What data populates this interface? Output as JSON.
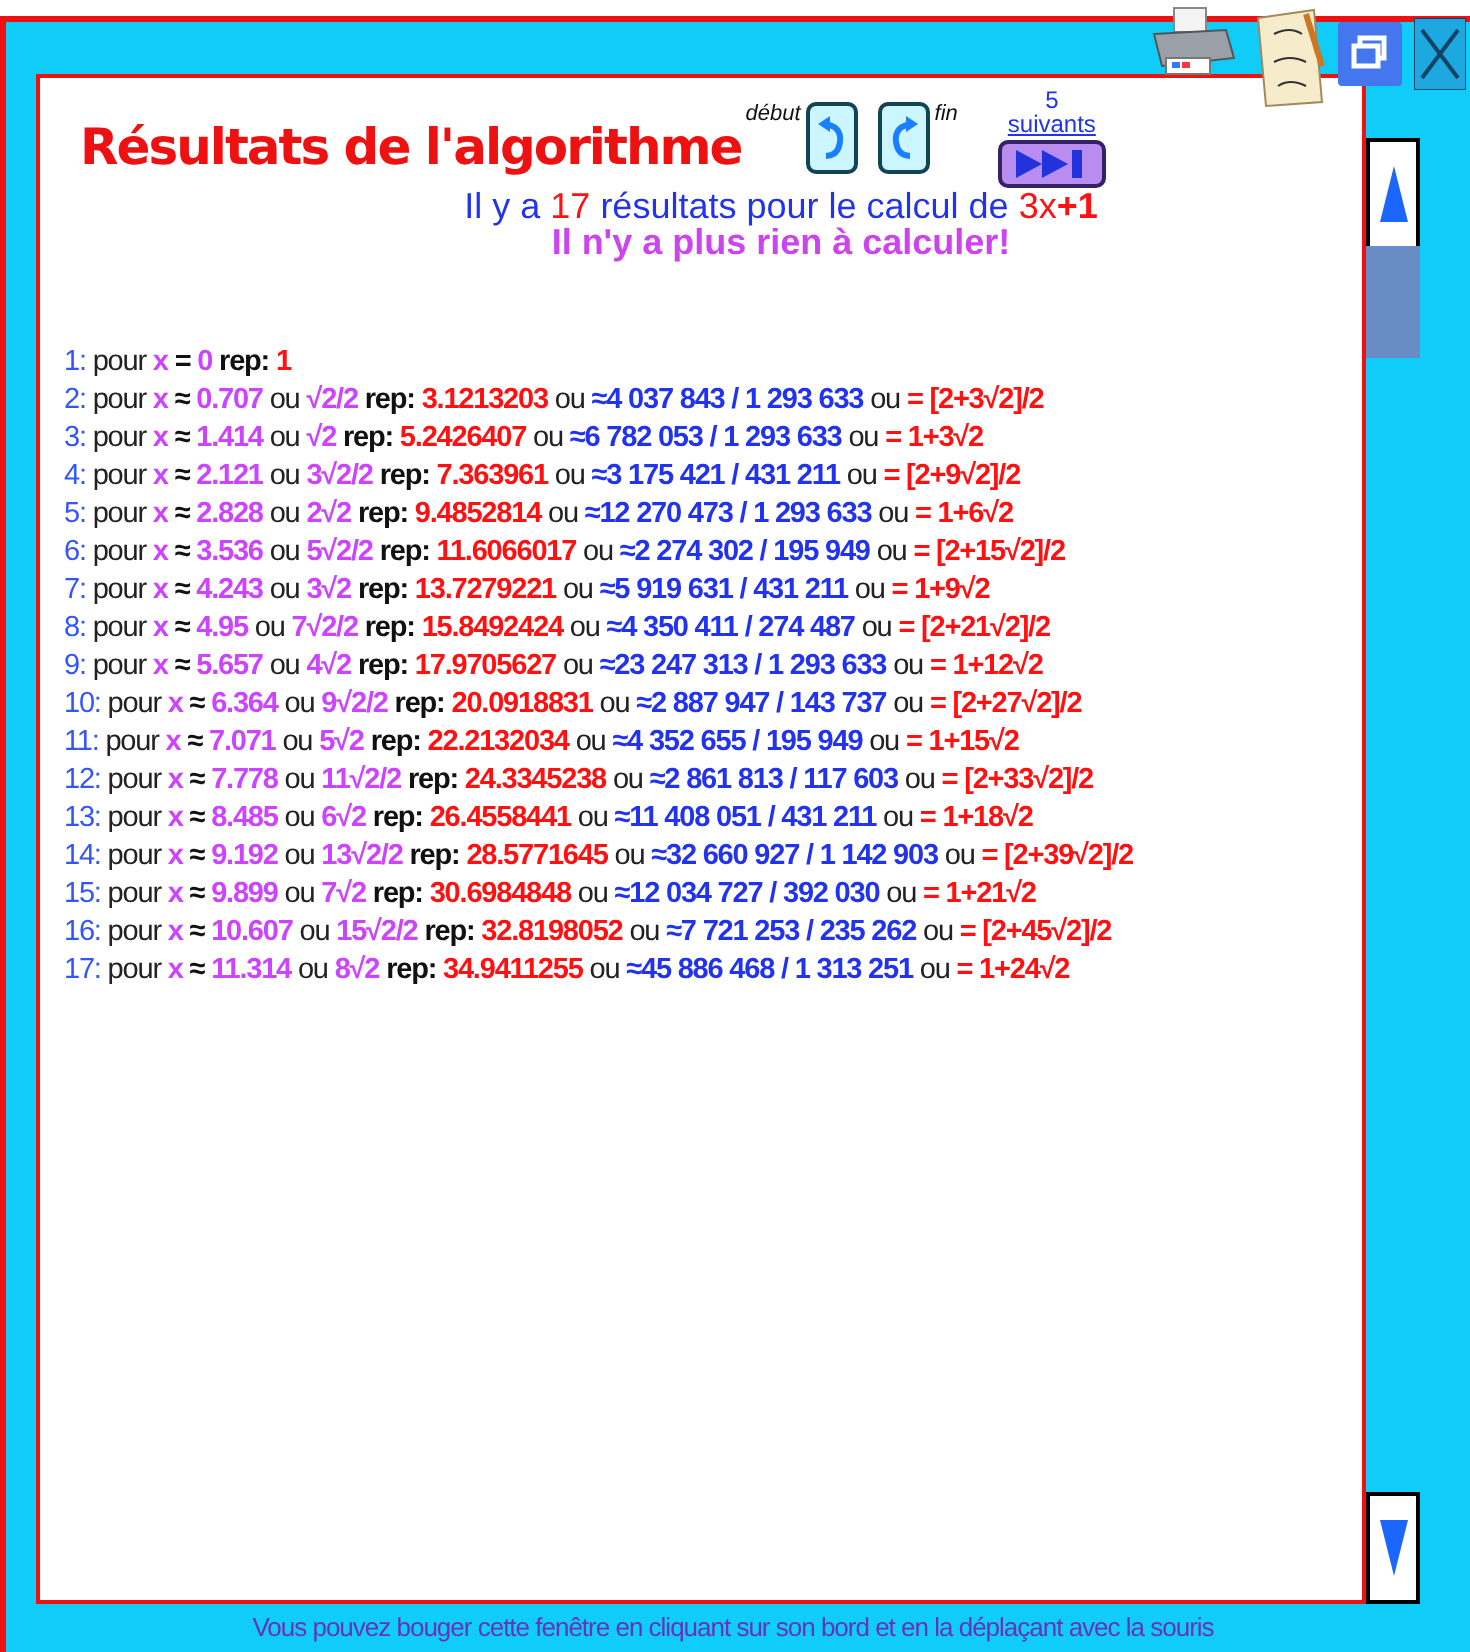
{
  "title": "Résultats de l'algorithme",
  "nav": {
    "start_label": "début",
    "end_label": "fin",
    "next_count": "5",
    "next_label": "suivants"
  },
  "summary": [
    {
      "kind": "text",
      "text": "Il y a "
    },
    {
      "kind": "num",
      "text": "17"
    },
    {
      "kind": "text",
      "text": " résultats pour le calcul de "
    },
    {
      "kind": "num",
      "text": "3x"
    },
    {
      "kind": "strong",
      "text": "+1"
    }
  ],
  "status": "Il n'y a plus rien à calculer!",
  "rows": [
    [
      {
        "kind": "index",
        "text": "1:"
      },
      {
        "kind": "word",
        "text": "pour"
      },
      {
        "kind": "var",
        "text": "x"
      },
      {
        "kind": "op",
        "text": "="
      },
      {
        "kind": "xval",
        "text": "0"
      },
      {
        "kind": "label",
        "text": "rep:"
      },
      {
        "kind": "rep",
        "text": "1"
      }
    ],
    [
      {
        "kind": "index",
        "text": "2:"
      },
      {
        "kind": "word",
        "text": "pour"
      },
      {
        "kind": "var",
        "text": "x"
      },
      {
        "kind": "op",
        "text": "≈"
      },
      {
        "kind": "xval",
        "text": "0.707"
      },
      {
        "kind": "word",
        "text": "ou"
      },
      {
        "kind": "xval",
        "text": "√2/2"
      },
      {
        "kind": "label",
        "text": "rep:"
      },
      {
        "kind": "rep",
        "text": "3.1213203"
      },
      {
        "kind": "word",
        "text": "ou"
      },
      {
        "kind": "frac",
        "text": "≈4 037 843 / 1 293 633"
      },
      {
        "kind": "word",
        "text": "ou"
      },
      {
        "kind": "rep",
        "text": "= [2+3√2]/2"
      }
    ],
    [
      {
        "kind": "index",
        "text": "3:"
      },
      {
        "kind": "word",
        "text": "pour"
      },
      {
        "kind": "var",
        "text": "x"
      },
      {
        "kind": "op",
        "text": "≈"
      },
      {
        "kind": "xval",
        "text": "1.414"
      },
      {
        "kind": "word",
        "text": "ou"
      },
      {
        "kind": "xval",
        "text": "√2"
      },
      {
        "kind": "label",
        "text": "rep:"
      },
      {
        "kind": "rep",
        "text": "5.2426407"
      },
      {
        "kind": "word",
        "text": "ou"
      },
      {
        "kind": "frac",
        "text": "≈6 782 053 / 1 293 633"
      },
      {
        "kind": "word",
        "text": "ou"
      },
      {
        "kind": "rep",
        "text": "= 1+3√2"
      }
    ],
    [
      {
        "kind": "index",
        "text": "4:"
      },
      {
        "kind": "word",
        "text": "pour"
      },
      {
        "kind": "var",
        "text": "x"
      },
      {
        "kind": "op",
        "text": "≈"
      },
      {
        "kind": "xval",
        "text": "2.121"
      },
      {
        "kind": "word",
        "text": "ou"
      },
      {
        "kind": "xval",
        "text": "3√2/2"
      },
      {
        "kind": "label",
        "text": "rep:"
      },
      {
        "kind": "rep",
        "text": "7.363961"
      },
      {
        "kind": "word",
        "text": "ou"
      },
      {
        "kind": "frac",
        "text": "≈3 175 421 / 431 211"
      },
      {
        "kind": "word",
        "text": "ou"
      },
      {
        "kind": "rep",
        "text": "= [2+9√2]/2"
      }
    ],
    [
      {
        "kind": "index",
        "text": "5:"
      },
      {
        "kind": "word",
        "text": "pour"
      },
      {
        "kind": "var",
        "text": "x"
      },
      {
        "kind": "op",
        "text": "≈"
      },
      {
        "kind": "xval",
        "text": "2.828"
      },
      {
        "kind": "word",
        "text": "ou"
      },
      {
        "kind": "xval",
        "text": "2√2"
      },
      {
        "kind": "label",
        "text": "rep:"
      },
      {
        "kind": "rep",
        "text": "9.4852814"
      },
      {
        "kind": "word",
        "text": "ou"
      },
      {
        "kind": "frac",
        "text": "≈12 270 473 / 1 293 633"
      },
      {
        "kind": "word",
        "text": "ou"
      },
      {
        "kind": "rep",
        "text": "= 1+6√2"
      }
    ],
    [
      {
        "kind": "index",
        "text": "6:"
      },
      {
        "kind": "word",
        "text": "pour"
      },
      {
        "kind": "var",
        "text": "x"
      },
      {
        "kind": "op",
        "text": "≈"
      },
      {
        "kind": "xval",
        "text": "3.536"
      },
      {
        "kind": "word",
        "text": "ou"
      },
      {
        "kind": "xval",
        "text": "5√2/2"
      },
      {
        "kind": "label",
        "text": "rep:"
      },
      {
        "kind": "rep",
        "text": "11.6066017"
      },
      {
        "kind": "word",
        "text": "ou"
      },
      {
        "kind": "frac",
        "text": "≈2 274 302 / 195 949"
      },
      {
        "kind": "word",
        "text": "ou"
      },
      {
        "kind": "rep",
        "text": "= [2+15√2]/2"
      }
    ],
    [
      {
        "kind": "index",
        "text": "7:"
      },
      {
        "kind": "word",
        "text": "pour"
      },
      {
        "kind": "var",
        "text": "x"
      },
      {
        "kind": "op",
        "text": "≈"
      },
      {
        "kind": "xval",
        "text": "4.243"
      },
      {
        "kind": "word",
        "text": "ou"
      },
      {
        "kind": "xval",
        "text": "3√2"
      },
      {
        "kind": "label",
        "text": "rep:"
      },
      {
        "kind": "rep",
        "text": "13.7279221"
      },
      {
        "kind": "word",
        "text": "ou"
      },
      {
        "kind": "frac",
        "text": "≈5 919 631 / 431 211"
      },
      {
        "kind": "word",
        "text": "ou"
      },
      {
        "kind": "rep",
        "text": "= 1+9√2"
      }
    ],
    [
      {
        "kind": "index",
        "text": "8:"
      },
      {
        "kind": "word",
        "text": "pour"
      },
      {
        "kind": "var",
        "text": "x"
      },
      {
        "kind": "op",
        "text": "≈"
      },
      {
        "kind": "xval",
        "text": "4.95"
      },
      {
        "kind": "word",
        "text": "ou"
      },
      {
        "kind": "xval",
        "text": "7√2/2"
      },
      {
        "kind": "label",
        "text": "rep:"
      },
      {
        "kind": "rep",
        "text": "15.8492424"
      },
      {
        "kind": "word",
        "text": "ou"
      },
      {
        "kind": "frac",
        "text": "≈4 350 411 / 274 487"
      },
      {
        "kind": "word",
        "text": "ou"
      },
      {
        "kind": "rep",
        "text": "= [2+21√2]/2"
      }
    ],
    [
      {
        "kind": "index",
        "text": "9:"
      },
      {
        "kind": "word",
        "text": "pour"
      },
      {
        "kind": "var",
        "text": "x"
      },
      {
        "kind": "op",
        "text": "≈"
      },
      {
        "kind": "xval",
        "text": "5.657"
      },
      {
        "kind": "word",
        "text": "ou"
      },
      {
        "kind": "xval",
        "text": "4√2"
      },
      {
        "kind": "label",
        "text": "rep:"
      },
      {
        "kind": "rep",
        "text": "17.9705627"
      },
      {
        "kind": "word",
        "text": "ou"
      },
      {
        "kind": "frac",
        "text": "≈23 247 313 / 1 293 633"
      },
      {
        "kind": "word",
        "text": "ou"
      },
      {
        "kind": "rep",
        "text": "= 1+12√2"
      }
    ],
    [
      {
        "kind": "index",
        "text": "10:"
      },
      {
        "kind": "word",
        "text": "pour"
      },
      {
        "kind": "var",
        "text": "x"
      },
      {
        "kind": "op",
        "text": "≈"
      },
      {
        "kind": "xval",
        "text": "6.364"
      },
      {
        "kind": "word",
        "text": "ou"
      },
      {
        "kind": "xval",
        "text": "9√2/2"
      },
      {
        "kind": "label",
        "text": "rep:"
      },
      {
        "kind": "rep",
        "text": "20.0918831"
      },
      {
        "kind": "word",
        "text": "ou"
      },
      {
        "kind": "frac",
        "text": "≈2 887 947 / 143 737"
      },
      {
        "kind": "word",
        "text": "ou"
      },
      {
        "kind": "rep",
        "text": "= [2+27√2]/2"
      }
    ],
    [
      {
        "kind": "index",
        "text": "11:"
      },
      {
        "kind": "word",
        "text": "pour"
      },
      {
        "kind": "var",
        "text": "x"
      },
      {
        "kind": "op",
        "text": "≈"
      },
      {
        "kind": "xval",
        "text": "7.071"
      },
      {
        "kind": "word",
        "text": "ou"
      },
      {
        "kind": "xval",
        "text": "5√2"
      },
      {
        "kind": "label",
        "text": "rep:"
      },
      {
        "kind": "rep",
        "text": "22.2132034"
      },
      {
        "kind": "word",
        "text": "ou"
      },
      {
        "kind": "frac",
        "text": "≈4 352 655 / 195 949"
      },
      {
        "kind": "word",
        "text": "ou"
      },
      {
        "kind": "rep",
        "text": "= 1+15√2"
      }
    ],
    [
      {
        "kind": "index",
        "text": "12:"
      },
      {
        "kind": "word",
        "text": "pour"
      },
      {
        "kind": "var",
        "text": "x"
      },
      {
        "kind": "op",
        "text": "≈"
      },
      {
        "kind": "xval",
        "text": "7.778"
      },
      {
        "kind": "word",
        "text": "ou"
      },
      {
        "kind": "xval",
        "text": "11√2/2"
      },
      {
        "kind": "label",
        "text": "rep:"
      },
      {
        "kind": "rep",
        "text": "24.3345238"
      },
      {
        "kind": "word",
        "text": "ou"
      },
      {
        "kind": "frac",
        "text": "≈2 861 813 / 117 603"
      },
      {
        "kind": "word",
        "text": "ou"
      },
      {
        "kind": "rep",
        "text": "= [2+33√2]/2"
      }
    ],
    [
      {
        "kind": "index",
        "text": "13:"
      },
      {
        "kind": "word",
        "text": "pour"
      },
      {
        "kind": "var",
        "text": "x"
      },
      {
        "kind": "op",
        "text": "≈"
      },
      {
        "kind": "xval",
        "text": "8.485"
      },
      {
        "kind": "word",
        "text": "ou"
      },
      {
        "kind": "xval",
        "text": "6√2"
      },
      {
        "kind": "label",
        "text": "rep:"
      },
      {
        "kind": "rep",
        "text": "26.4558441"
      },
      {
        "kind": "word",
        "text": "ou"
      },
      {
        "kind": "frac",
        "text": "≈11 408 051 / 431 211"
      },
      {
        "kind": "word",
        "text": "ou"
      },
      {
        "kind": "rep",
        "text": "= 1+18√2"
      }
    ],
    [
      {
        "kind": "index",
        "text": "14:"
      },
      {
        "kind": "word",
        "text": "pour"
      },
      {
        "kind": "var",
        "text": "x"
      },
      {
        "kind": "op",
        "text": "≈"
      },
      {
        "kind": "xval",
        "text": "9.192"
      },
      {
        "kind": "word",
        "text": "ou"
      },
      {
        "kind": "xval",
        "text": "13√2/2"
      },
      {
        "kind": "label",
        "text": "rep:"
      },
      {
        "kind": "rep",
        "text": "28.5771645"
      },
      {
        "kind": "word",
        "text": "ou"
      },
      {
        "kind": "frac",
        "text": "≈32 660 927 / 1 142 903"
      },
      {
        "kind": "word",
        "text": "ou"
      },
      {
        "kind": "rep",
        "text": "= [2+39√2]/2"
      }
    ],
    [
      {
        "kind": "index",
        "text": "15:"
      },
      {
        "kind": "word",
        "text": "pour"
      },
      {
        "kind": "var",
        "text": "x"
      },
      {
        "kind": "op",
        "text": "≈"
      },
      {
        "kind": "xval",
        "text": "9.899"
      },
      {
        "kind": "word",
        "text": "ou"
      },
      {
        "kind": "xval",
        "text": "7√2"
      },
      {
        "kind": "label",
        "text": "rep:"
      },
      {
        "kind": "rep",
        "text": "30.6984848"
      },
      {
        "kind": "word",
        "text": "ou"
      },
      {
        "kind": "frac",
        "text": "≈12 034 727 / 392 030"
      },
      {
        "kind": "word",
        "text": "ou"
      },
      {
        "kind": "rep",
        "text": "= 1+21√2"
      }
    ],
    [
      {
        "kind": "index",
        "text": "16:"
      },
      {
        "kind": "word",
        "text": "pour"
      },
      {
        "kind": "var",
        "text": "x"
      },
      {
        "kind": "op",
        "text": "≈"
      },
      {
        "kind": "xval",
        "text": "10.607"
      },
      {
        "kind": "word",
        "text": "ou"
      },
      {
        "kind": "xval",
        "text": "15√2/2"
      },
      {
        "kind": "label",
        "text": "rep:"
      },
      {
        "kind": "rep",
        "text": "32.8198052"
      },
      {
        "kind": "word",
        "text": "ou"
      },
      {
        "kind": "frac",
        "text": "≈7 721 253 / 235 262"
      },
      {
        "kind": "word",
        "text": "ou"
      },
      {
        "kind": "rep",
        "text": "= [2+45√2]/2"
      }
    ],
    [
      {
        "kind": "index",
        "text": "17:"
      },
      {
        "kind": "word",
        "text": "pour"
      },
      {
        "kind": "var",
        "text": "x"
      },
      {
        "kind": "op",
        "text": "≈"
      },
      {
        "kind": "xval",
        "text": "11.314"
      },
      {
        "kind": "word",
        "text": "ou"
      },
      {
        "kind": "xval",
        "text": "8√2"
      },
      {
        "kind": "label",
        "text": "rep:"
      },
      {
        "kind": "rep",
        "text": "34.9411255"
      },
      {
        "kind": "word",
        "text": "ou"
      },
      {
        "kind": "frac",
        "text": "≈45 886 468 / 1 313 251"
      },
      {
        "kind": "word",
        "text": "ou"
      },
      {
        "kind": "rep",
        "text": "= 1+24√2"
      }
    ]
  ],
  "footer": "Vous pouvez bouger cette fenêtre en cliquant sur son bord et en la déplaçant avec la souris"
}
